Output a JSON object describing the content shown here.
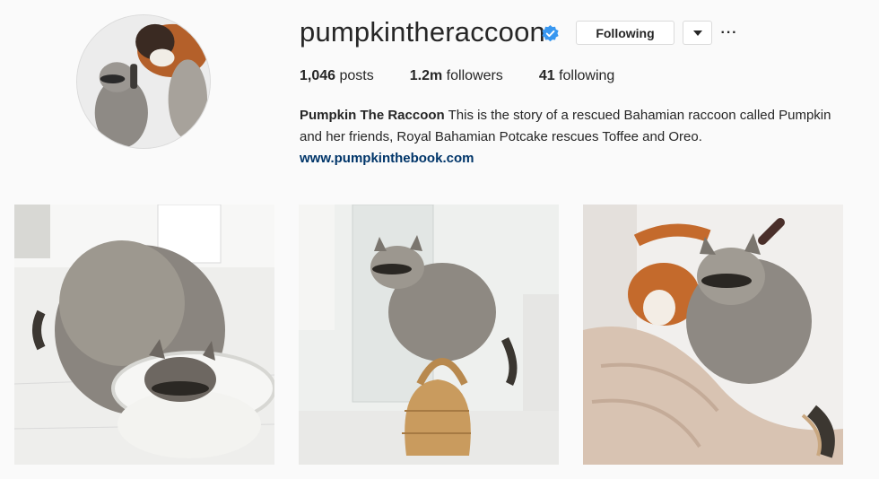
{
  "profile": {
    "username": "pumpkintheraccoon",
    "verified": true,
    "follow_button_label": "Following",
    "dropdown_icon": "caret-down-icon",
    "more_icon": "ellipsis-icon",
    "more_label": "···"
  },
  "stats": {
    "posts_count": "1,046",
    "posts_label": "posts",
    "followers_count": "1.2m",
    "followers_label": "followers",
    "following_count": "41",
    "following_label": "following"
  },
  "bio": {
    "name": "Pumpkin The Raccoon",
    "text": "This is the story of a rescued Bahamian raccoon called Pumpkin and her friends, Royal Bahamian Potcake rescues Toffee and Oreo.",
    "link": "www.pumpkinthebook.com"
  },
  "posts": [
    {
      "description": "raccoon-eating-from-bowl"
    },
    {
      "description": "raccoon-on-wicker-basket"
    },
    {
      "description": "raccoon-with-dog-on-blanket"
    }
  ],
  "colors": {
    "background": "#fafafa",
    "verified_badge": "#3897f0",
    "link": "#003569",
    "border": "#dbdbdb"
  }
}
